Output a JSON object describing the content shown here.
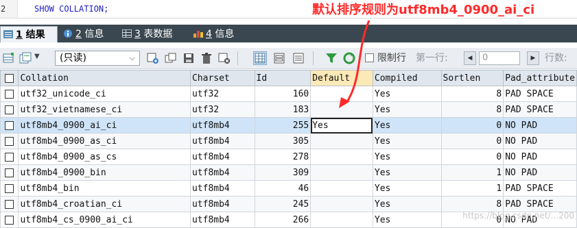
{
  "editor": {
    "line_number": "2",
    "code": "SHOW COLLATION;"
  },
  "annotation": "默认排序规则为utf8mb4_0900_ai_ci",
  "tabs": [
    {
      "number": "1",
      "label": "结果",
      "icon": "grid-result-icon"
    },
    {
      "number": "2",
      "label": "信息",
      "icon": "info-icon"
    },
    {
      "number": "3",
      "label": "表数据",
      "icon": "table-data-icon"
    },
    {
      "number": "4",
      "label": "信息",
      "icon": "chart-info-icon"
    }
  ],
  "toolbar": {
    "mode_select": "(只读)",
    "limit_label": "限制行",
    "start_label": "第一行:",
    "start_value": "0",
    "rows_label": "行数:"
  },
  "grid": {
    "columns": [
      "Collation",
      "Charset",
      "Id",
      "Default",
      "Compiled",
      "Sortlen",
      "Pad_attribute"
    ],
    "rows": [
      {
        "collation": "utf32_unicode_ci",
        "charset": "utf32",
        "id": "160",
        "default": "",
        "compiled": "Yes",
        "sortlen": "8",
        "pad": "PAD SPACE"
      },
      {
        "collation": "utf32_vietnamese_ci",
        "charset": "utf32",
        "id": "183",
        "default": "",
        "compiled": "Yes",
        "sortlen": "8",
        "pad": "PAD SPACE"
      },
      {
        "collation": "utf8mb4_0900_ai_ci",
        "charset": "utf8mb4",
        "id": "255",
        "default": "Yes",
        "compiled": "Yes",
        "sortlen": "0",
        "pad": "NO PAD"
      },
      {
        "collation": "utf8mb4_0900_as_ci",
        "charset": "utf8mb4",
        "id": "305",
        "default": "",
        "compiled": "Yes",
        "sortlen": "0",
        "pad": "NO PAD"
      },
      {
        "collation": "utf8mb4_0900_as_cs",
        "charset": "utf8mb4",
        "id": "278",
        "default": "",
        "compiled": "Yes",
        "sortlen": "0",
        "pad": "NO PAD"
      },
      {
        "collation": "utf8mb4_0900_bin",
        "charset": "utf8mb4",
        "id": "309",
        "default": "",
        "compiled": "Yes",
        "sortlen": "1",
        "pad": "NO PAD"
      },
      {
        "collation": "utf8mb4_bin",
        "charset": "utf8mb4",
        "id": "46",
        "default": "",
        "compiled": "Yes",
        "sortlen": "1",
        "pad": "PAD SPACE"
      },
      {
        "collation": "utf8mb4_croatian_ci",
        "charset": "utf8mb4",
        "id": "245",
        "default": "",
        "compiled": "Yes",
        "sortlen": "8",
        "pad": "PAD SPACE"
      },
      {
        "collation": "utf8mb4_cs_0900_ai_ci",
        "charset": "utf8mb4",
        "id": "266",
        "default": "",
        "compiled": "Yes",
        "sortlen": "0",
        "pad": "NO PAD"
      }
    ]
  },
  "watermark": "https://blog.csdn.net/...200",
  "colors": {
    "tab_bar": "#3a4750",
    "header": "#dfe6ee",
    "current_row": "#cfe4f8",
    "annotation": "#ff2a2a"
  }
}
